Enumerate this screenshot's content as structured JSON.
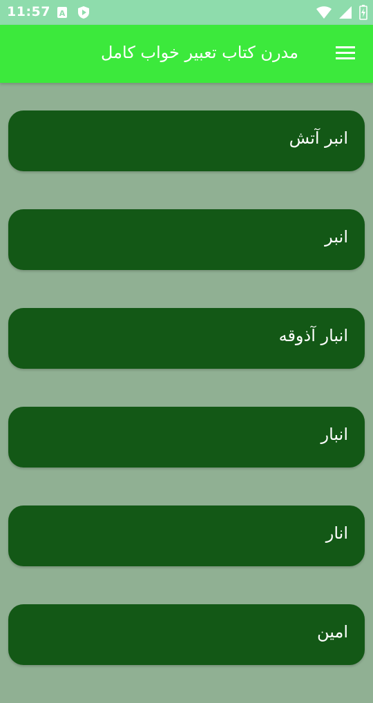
{
  "status_bar": {
    "time": "11:57",
    "left_icons": [
      "sim-a-icon",
      "shield-play-icon"
    ],
    "right_icons": [
      "wifi-icon",
      "signal-icon",
      "battery-charging-icon"
    ]
  },
  "app_bar": {
    "title": "مدرن کتاب تعبیر خواب کامل",
    "menu_icon": "hamburger-menu-icon",
    "background": "#3ce93c"
  },
  "list": {
    "item_background": "#135816",
    "items": [
      {
        "label": "انبر آتش"
      },
      {
        "label": "انبر"
      },
      {
        "label": "انبار آذوقه"
      },
      {
        "label": "انبار"
      },
      {
        "label": "انار"
      },
      {
        "label": "امین"
      }
    ]
  }
}
